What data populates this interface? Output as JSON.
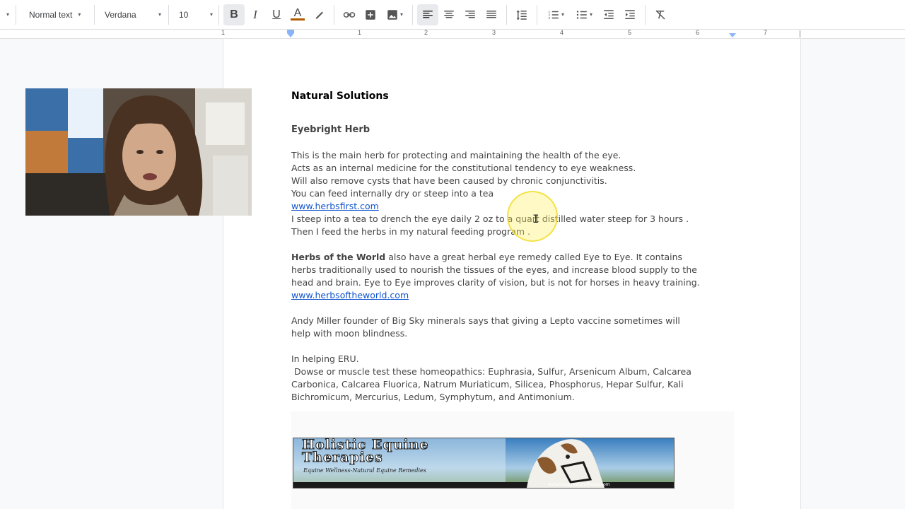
{
  "toolbar": {
    "style_dropdown": "Normal text",
    "font_dropdown": "Verdana",
    "size_dropdown": "10",
    "bold": "B",
    "italic": "I",
    "underline": "U",
    "text_color": "A"
  },
  "ruler": {
    "numbers": [
      "1",
      "1",
      "2",
      "3",
      "4",
      "5",
      "6",
      "7"
    ]
  },
  "document": {
    "title": "Natural Solutions",
    "heading": "Eyebright Herb",
    "para1": [
      "This is the main herb for protecting and maintaining the health of the eye.",
      "Acts as an internal medicine for the constitutional tendency to eye weakness.",
      "Will also remove cysts that have been caused by chronic conjunctivitis.",
      "You can feed internally dry or steep into a tea"
    ],
    "link1": "www.herbsfirst.com",
    "para2": [
      "I steep into a tea to drench the eye daily 2 oz to a quart distilled water steep for 3 hours .",
      "Then I feed the herbs in my natural feeding program ."
    ],
    "para3_bold": "Herbs of the World",
    "para3_line1_rest": " also have a great herbal eye remedy called Eye to Eye. It contains",
    "para3_lines": [
      "herbs traditionally used to nourish the tissues of the eyes, and increase blood supply to the",
      "head and brain. Eye to Eye improves clarity of vision, but is not for horses in heavy training."
    ],
    "link2": "www.herbsoftheworld.com",
    "para4": [
      "Andy  Miller founder of Big Sky minerals says that giving a Lepto vaccine sometimes will",
      "help with moon blindness."
    ],
    "para5": [
      "In helping ERU.",
      " Dowse or muscle test these homeopathics: Euphrasia, Sulfur, Arsenicum Album, Calcarea",
      "Carbonica, Calcarea Fluorica, Natrum Muriaticum, Silicea, Phosphorus, Hepar Sulfur, Kali",
      "Bichromicum, Mercurius, Ledum, Symphytum, and Antimonium."
    ]
  },
  "banner": {
    "title_line1": "Holistic Equine",
    "title_line2": "Therapies",
    "tagline": "Equine Wellness-Natural Equine Remedies",
    "url": "www.happynaturalhorse.com"
  },
  "colors": {
    "link": "#1155cc",
    "text": "#444444",
    "cursor_highlight": "#fff05a"
  }
}
